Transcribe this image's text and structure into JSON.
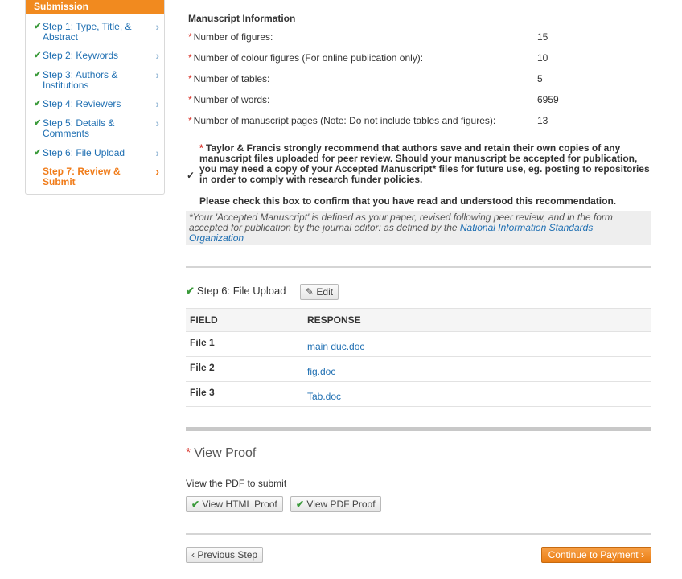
{
  "sidebar": {
    "header": "Submission",
    "items": [
      {
        "label": "Step 1: Type, Title, & Abstract",
        "done": true
      },
      {
        "label": "Step 2: Keywords",
        "done": true
      },
      {
        "label": "Step 3: Authors & Institutions",
        "done": true
      },
      {
        "label": "Step 4: Reviewers",
        "done": true
      },
      {
        "label": "Step 5: Details & Comments",
        "done": true
      },
      {
        "label": "Step 6: File Upload",
        "done": true
      },
      {
        "label": "Step 7: Review & Submit",
        "done": false,
        "current": true
      }
    ]
  },
  "manuscript": {
    "title": "Manuscript Information",
    "rows": [
      {
        "label": "Number of figures:",
        "value": "15"
      },
      {
        "label": "Number of colour figures (For online publication only):",
        "value": "10"
      },
      {
        "label": "Number of tables:",
        "value": "5"
      },
      {
        "label": "Number of words:",
        "value": "6959"
      },
      {
        "label": "Number of manuscript pages (Note: Do not include tables and figures):",
        "value": "13"
      }
    ]
  },
  "notice": {
    "text": "Taylor & Francis strongly recommend that authors save and retain their own copies of any manuscript files uploaded for peer review. Should your manuscript be accepted for publication, you may need a copy of your Accepted Manuscript* files for future use, eg. posting to repositories in order to comply with research funder policies.",
    "confirm": "Please check this box to confirm that you have read and understood this recommendation.",
    "checked": true
  },
  "footnote": {
    "text": "*Your 'Accepted Manuscript' is defined as your paper, revised following peer review, and in the form accepted for publication by the journal editor: as defined by the ",
    "link": "National Information Standards Organization"
  },
  "file_upload": {
    "title": "Step 6: File Upload",
    "edit_label": "Edit",
    "headers": {
      "field": "FIELD",
      "response": "RESPONSE"
    },
    "rows": [
      {
        "field": "File 1",
        "response": "main duc.doc"
      },
      {
        "field": "File 2",
        "response": "fig.doc"
      },
      {
        "field": "File 3",
        "response": "Tab.doc"
      }
    ]
  },
  "view_proof": {
    "title": "View Proof",
    "subtitle": "View the PDF to submit",
    "html_button": "View HTML Proof",
    "pdf_button": "View PDF Proof"
  },
  "nav": {
    "prev_label": "Previous Step",
    "next_label": "Continue to Payment"
  },
  "colors": {
    "accent": "#f18a1f",
    "link": "#1f6fb2",
    "check": "#3a9a3a",
    "required": "#d9342b"
  }
}
